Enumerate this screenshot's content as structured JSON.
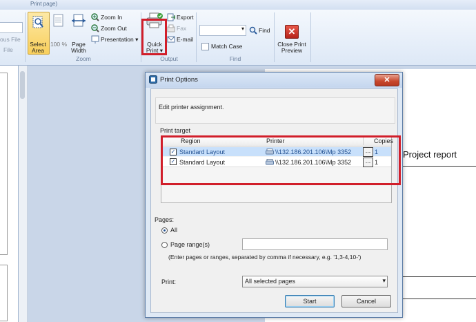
{
  "window": {
    "title_fragment": "Print page)"
  },
  "ribbon": {
    "left_partial": {
      "line1": "ous File",
      "line2": "File"
    },
    "zoom_group": {
      "label": "Zoom",
      "select_area": "Select Area",
      "zoom100": "100 %",
      "page_width": "Page Width",
      "zoom_in": "Zoom In",
      "zoom_out": "Zoom Out",
      "presentation": "Presentation"
    },
    "output_group": {
      "label": "Output",
      "quick_print": "Quick Print",
      "export": "Export",
      "fax": "Fax",
      "email": "E-mail"
    },
    "find_group": {
      "label": "Find",
      "find": "Find",
      "match_case": "Match Case",
      "search_value": ""
    },
    "close_preview": "Close Print Preview"
  },
  "report": {
    "heading": "Project report"
  },
  "dialog": {
    "title": "Print Options",
    "description": "Edit printer assignment.",
    "print_target_label": "Print target",
    "columns": {
      "region": "Region",
      "printer": "Printer",
      "copies": "Copies"
    },
    "rows": [
      {
        "region": "Standard Layout",
        "printer": "\\\\132.186.201.106\\Mp 3352",
        "copies": "1",
        "checked": true,
        "selected": true
      },
      {
        "region": "Standard Layout",
        "printer": "\\\\132.186.201.106\\Mp 3352",
        "copies": "1",
        "checked": true,
        "selected": false
      }
    ],
    "ellipsis": "...",
    "pages_label": "Pages:",
    "all_label": "All",
    "range_label": "Page range(s)",
    "range_value": "",
    "hint": "(Enter pages or ranges, separated by comma if necessary, e.g. '1,3-4,10-')",
    "print_label": "Print:",
    "print_option": "All selected pages",
    "start": "Start",
    "cancel": "Cancel"
  },
  "colors": {
    "highlight_red": "#d11e2a",
    "selection_blue": "#c8e0fb",
    "link_blue": "#1f4e8f"
  }
}
